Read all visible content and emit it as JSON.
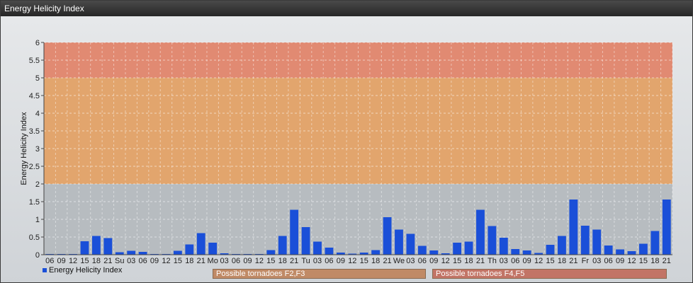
{
  "window": {
    "title": "Energy Helicity Index"
  },
  "colors": {
    "bar": "#1a4fd8",
    "band_low": "#b7bcc0",
    "band_mid": "#e2a56d",
    "band_high": "#e18a72",
    "zone_mid": "#c08a66",
    "zone_high": "#c27466"
  },
  "legend": {
    "label": "Energy Helicity Index"
  },
  "zones": [
    {
      "label": "Possible tornadoes F2,F3",
      "color_key": "zone_mid"
    },
    {
      "label": "Possible tornadoes F4,F5",
      "color_key": "zone_high"
    }
  ],
  "chart_data": {
    "type": "bar",
    "title": "Energy Helicity Index",
    "ylabel": "Energy Helicity Index",
    "xlabel": "",
    "ylim": [
      0,
      6
    ],
    "yticks": [
      0,
      0.5,
      1,
      1.5,
      2,
      2.5,
      3,
      3.5,
      4,
      4.5,
      5,
      5.5,
      6
    ],
    "ytick_labels": [
      "0",
      "0.5",
      "1",
      "1.5",
      "2",
      "2.5",
      "3",
      "3.5",
      "4",
      "4.5",
      "5",
      "5.5",
      "6"
    ],
    "grid": true,
    "legend_position": "bottom-left",
    "bands": [
      {
        "from": 0,
        "to": 2,
        "color_key": "band_low"
      },
      {
        "from": 2,
        "to": 5,
        "color_key": "band_mid"
      },
      {
        "from": 5,
        "to": 6,
        "color_key": "band_high"
      }
    ],
    "categories": [
      "06",
      "09",
      "12",
      "15",
      "18",
      "21",
      "Su",
      "03",
      "06",
      "09",
      "12",
      "15",
      "18",
      "21",
      "Mo",
      "03",
      "06",
      "09",
      "12",
      "15",
      "18",
      "21",
      "Tu",
      "03",
      "06",
      "09",
      "12",
      "15",
      "18",
      "21",
      "We",
      "03",
      "06",
      "09",
      "12",
      "15",
      "18",
      "21",
      "Th",
      "03",
      "06",
      "09",
      "12",
      "15",
      "18",
      "21",
      "Fr",
      "03",
      "06",
      "09",
      "12",
      "15",
      "18",
      "21"
    ],
    "series": [
      {
        "name": "Energy Helicity Index",
        "values": [
          0.02,
          0.02,
          0.02,
          0.38,
          0.53,
          0.47,
          0.07,
          0.11,
          0.08,
          0.02,
          0.02,
          0.11,
          0.29,
          0.61,
          0.34,
          0.04,
          0.02,
          0.02,
          0.02,
          0.13,
          0.53,
          1.27,
          0.78,
          0.37,
          0.2,
          0.06,
          0.03,
          0.06,
          0.13,
          1.06,
          0.71,
          0.59,
          0.25,
          0.12,
          0.04,
          0.34,
          0.37,
          1.27,
          0.81,
          0.48,
          0.16,
          0.12,
          0.05,
          0.28,
          0.53,
          1.56,
          0.82,
          0.71,
          0.26,
          0.15,
          0.1,
          0.31,
          0.67,
          1.56
        ]
      }
    ]
  }
}
